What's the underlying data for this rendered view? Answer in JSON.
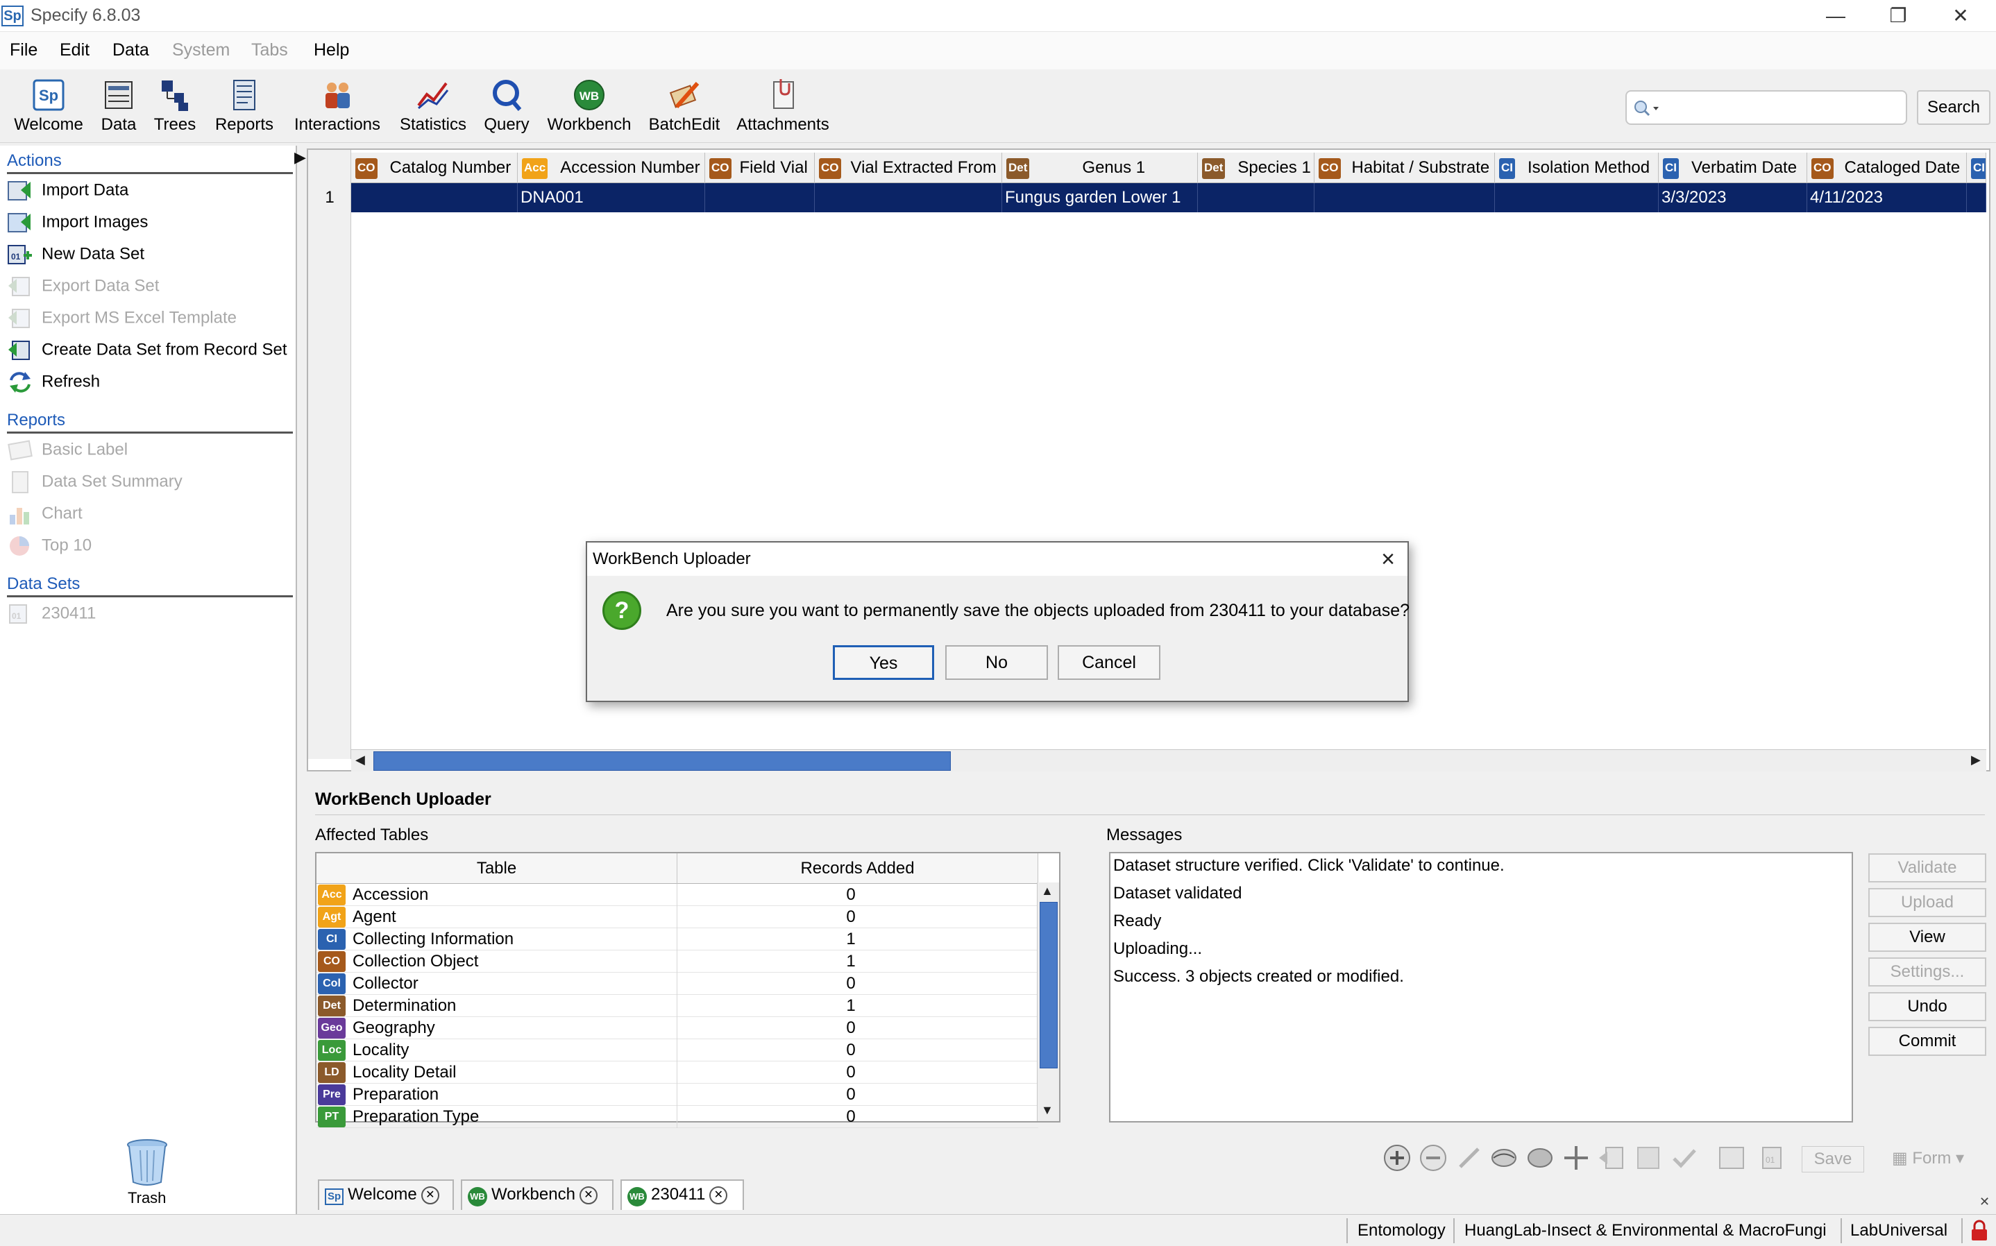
{
  "window": {
    "title": "Specify 6.8.03",
    "app_icon_text": "Sp",
    "controls": [
      "—",
      "❐",
      "✕"
    ]
  },
  "menu": [
    {
      "label": "File",
      "enabled": true
    },
    {
      "label": "Edit",
      "enabled": true
    },
    {
      "label": "Data",
      "enabled": true
    },
    {
      "label": "System",
      "enabled": false
    },
    {
      "label": "Tabs",
      "enabled": false
    },
    {
      "label": "Help",
      "enabled": true
    }
  ],
  "toolbar": {
    "buttons": [
      "Welcome",
      "Data",
      "Trees",
      "Reports",
      "Interactions",
      "Statistics",
      "Query",
      "Workbench",
      "BatchEdit",
      "Attachments"
    ],
    "search_value": "",
    "search_button": "Search"
  },
  "left_panel": {
    "actions_header": "Actions",
    "actions": [
      {
        "label": "Import Data",
        "enabled": true
      },
      {
        "label": "Import Images",
        "enabled": true
      },
      {
        "label": "New Data Set",
        "enabled": true
      },
      {
        "label": "Export Data Set",
        "enabled": false
      },
      {
        "label": "Export MS Excel Template",
        "enabled": false
      },
      {
        "label": "Create Data Set from Record Set",
        "enabled": true
      },
      {
        "label": "Refresh",
        "enabled": true
      }
    ],
    "reports_header": "Reports",
    "reports": [
      {
        "label": "Basic Label",
        "enabled": false
      },
      {
        "label": "Data Set Summary",
        "enabled": false
      },
      {
        "label": "Chart",
        "enabled": false
      },
      {
        "label": "Top 10",
        "enabled": false
      }
    ],
    "datasets_header": "Data Sets",
    "datasets": [
      {
        "label": "230411",
        "enabled": false
      }
    ],
    "trash_label": "Trash"
  },
  "grid": {
    "columns": [
      {
        "badge": "CO",
        "label": "Catalog Number"
      },
      {
        "badge": "Acc",
        "label": "Accession Number"
      },
      {
        "badge": "CO",
        "label": "Field Vial"
      },
      {
        "badge": "CO",
        "label": "Vial Extracted From"
      },
      {
        "badge": "Det",
        "label": "Genus 1"
      },
      {
        "badge": "Det",
        "label": "Species 1"
      },
      {
        "badge": "CO",
        "label": "Habitat / Substrate"
      },
      {
        "badge": "CI",
        "label": "Isolation Method"
      },
      {
        "badge": "CI",
        "label": "Verbatim Date"
      },
      {
        "badge": "CO",
        "label": "Cataloged Date"
      },
      {
        "badge": "CI",
        "label": ""
      }
    ],
    "rows": [
      {
        "num": "1",
        "cells": [
          "",
          "DNA001",
          "",
          "",
          "Fungus garden Lower 1",
          "",
          "",
          "",
          "3/3/2023",
          "4/11/2023",
          ""
        ]
      }
    ]
  },
  "uploader": {
    "title": "WorkBench Uploader",
    "affected_tables_label": "Affected Tables",
    "table_header": "Table",
    "records_header": "Records Added",
    "tables": [
      {
        "badge": "Acc",
        "color": "#f1a319",
        "name": "Accession",
        "added": "0"
      },
      {
        "badge": "Agt",
        "color": "#f1a319",
        "name": "Agent",
        "added": "0"
      },
      {
        "badge": "CI",
        "color": "#2b62b0",
        "name": "Collecting Information",
        "added": "1"
      },
      {
        "badge": "CO",
        "color": "#a5591b",
        "name": "Collection Object",
        "added": "1"
      },
      {
        "badge": "Col",
        "color": "#2b62b0",
        "name": "Collector",
        "added": "0"
      },
      {
        "badge": "Det",
        "color": "#8b5a2b",
        "name": "Determination",
        "added": "1"
      },
      {
        "badge": "Geo",
        "color": "#6a3a9a",
        "name": "Geography",
        "added": "0"
      },
      {
        "badge": "Loc",
        "color": "#3a9a3a",
        "name": "Locality",
        "added": "0"
      },
      {
        "badge": "LD",
        "color": "#8b5a2b",
        "name": "Locality Detail",
        "added": "0"
      },
      {
        "badge": "Pre",
        "color": "#4a3a9a",
        "name": "Preparation",
        "added": "0"
      },
      {
        "badge": "PT",
        "color": "#3a9a3a",
        "name": "Preparation Type",
        "added": "0"
      }
    ],
    "messages_label": "Messages",
    "messages": [
      "Dataset structure verified. Click 'Validate' to continue.",
      "Dataset validated",
      "Ready",
      "Uploading...",
      "Success. 3 objects created or modified."
    ],
    "buttons": [
      {
        "label": "Validate",
        "enabled": false
      },
      {
        "label": "Upload",
        "enabled": false
      },
      {
        "label": "View",
        "enabled": true
      },
      {
        "label": "Settings...",
        "enabled": false
      },
      {
        "label": "Undo",
        "enabled": true
      },
      {
        "label": "Commit",
        "enabled": true
      }
    ]
  },
  "bottom_bar": {
    "save_label": "Save",
    "form_label": "Form"
  },
  "tabs": [
    {
      "label": "Welcome",
      "icon": "Sp"
    },
    {
      "label": "Workbench",
      "icon": "WB"
    },
    {
      "label": "230411",
      "icon": "WB",
      "active": true
    }
  ],
  "status": {
    "discipline": "Entomology",
    "collection": "HuangLab-Insect & Environmental & MacroFungi",
    "user": "LabUniversal"
  },
  "dialog": {
    "title": "WorkBench Uploader",
    "message": "Are you sure you want to permanently save the objects uploaded from 230411 to your database?",
    "yes": "Yes",
    "no": "No",
    "cancel": "Cancel"
  }
}
